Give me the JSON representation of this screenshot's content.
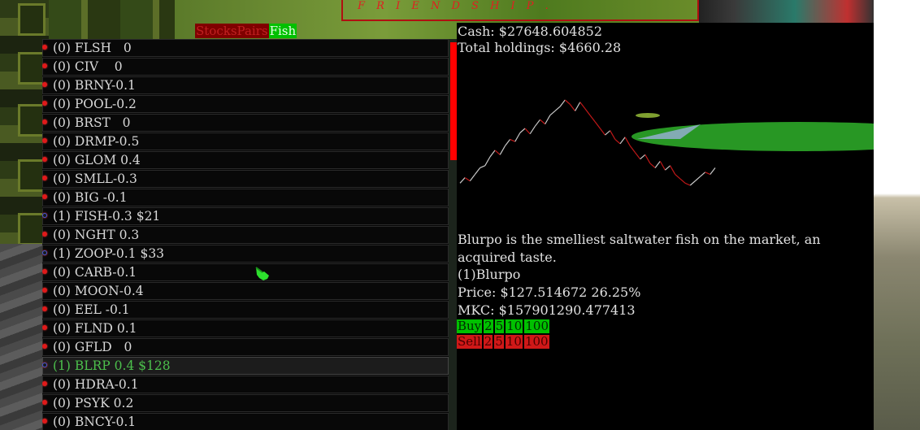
{
  "background": {
    "banner_text": "F R I E N D S H I P ."
  },
  "tabs": [
    {
      "label": "StocksPairs",
      "active": false
    },
    {
      "label": "Fish",
      "active": true
    }
  ],
  "stocks": [
    {
      "text": "(0) FLSH   0",
      "owned": false,
      "selected": false
    },
    {
      "text": "(0) CIV    0",
      "owned": false,
      "selected": false
    },
    {
      "text": "(0) BRNY-0.1",
      "owned": false,
      "selected": false
    },
    {
      "text": "(0) POOL-0.2",
      "owned": false,
      "selected": false
    },
    {
      "text": "(0) BRST   0",
      "owned": false,
      "selected": false
    },
    {
      "text": "(0) DRMP-0.5",
      "owned": false,
      "selected": false
    },
    {
      "text": "(0) GLOM 0.4",
      "owned": false,
      "selected": false
    },
    {
      "text": "(0) SMLL-0.3",
      "owned": false,
      "selected": false
    },
    {
      "text": "(0) BIG -0.1",
      "owned": false,
      "selected": false
    },
    {
      "text": "(1) FISH-0.3 $21",
      "owned": true,
      "selected": false
    },
    {
      "text": "(0) NGHT 0.3",
      "owned": false,
      "selected": false
    },
    {
      "text": "(1) ZOOP-0.1 $33",
      "owned": true,
      "selected": false
    },
    {
      "text": "(0) CARB-0.1",
      "owned": false,
      "selected": false
    },
    {
      "text": "(0) MOON-0.4",
      "owned": false,
      "selected": false
    },
    {
      "text": "(0) EEL -0.1",
      "owned": false,
      "selected": false
    },
    {
      "text": "(0) FLND 0.1",
      "owned": false,
      "selected": false
    },
    {
      "text": "(0) GFLD   0",
      "owned": false,
      "selected": false
    },
    {
      "text": "(1) BLRP 0.4 $128",
      "owned": true,
      "selected": true
    },
    {
      "text": "(0) HDRA-0.1",
      "owned": false,
      "selected": false
    },
    {
      "text": "(0) PSYK 0.2",
      "owned": false,
      "selected": false
    },
    {
      "text": "(0) BNCY-0.1",
      "owned": false,
      "selected": false
    }
  ],
  "info": {
    "cash": "Cash: $27648.604852",
    "holdings": "Total holdings: $4660.28",
    "description": "Blurpo is the smelliest saltwater fish on the market, an acquired taste.",
    "name": "(1)Blurpo",
    "price": "Price: $127.514672 26.25%",
    "mkc": "MKC: $157901290.477413"
  },
  "buy": {
    "label": "Buy",
    "amounts": [
      "2",
      "5",
      "10",
      "100"
    ]
  },
  "sell": {
    "label": "Sell",
    "amounts": [
      "2",
      "5",
      "10",
      "100"
    ]
  },
  "chart_data": {
    "type": "line",
    "colors": {
      "up": "#c8c8c8",
      "down": "#c01818"
    },
    "values": [
      4,
      9,
      6,
      12,
      18,
      20,
      28,
      34,
      30,
      38,
      44,
      42,
      50,
      54,
      49,
      56,
      62,
      58,
      66,
      70,
      74,
      80,
      76,
      70,
      78,
      72,
      66,
      60,
      54,
      48,
      52,
      44,
      40,
      46,
      38,
      32,
      26,
      30,
      22,
      18,
      24,
      16,
      20,
      12,
      8,
      4,
      2,
      6,
      10,
      14,
      12,
      18
    ]
  }
}
